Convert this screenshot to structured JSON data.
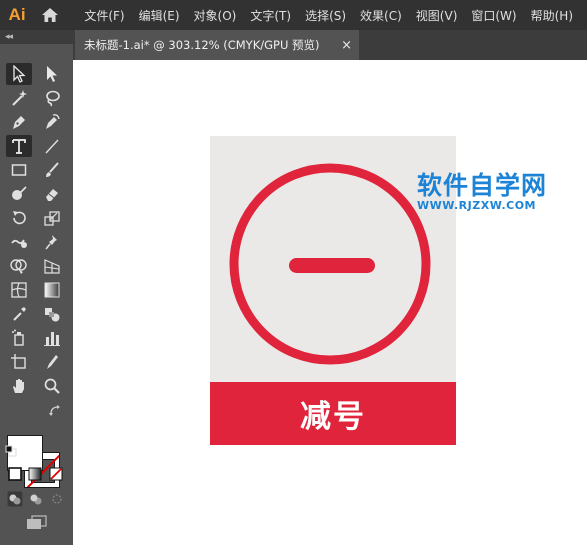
{
  "app": {
    "logo_text": "Ai",
    "accent": "#f79e32"
  },
  "menu": {
    "items": [
      {
        "label": "文件(F)"
      },
      {
        "label": "编辑(E)"
      },
      {
        "label": "对象(O)"
      },
      {
        "label": "文字(T)"
      },
      {
        "label": "选择(S)"
      },
      {
        "label": "效果(C)"
      },
      {
        "label": "视图(V)"
      },
      {
        "label": "窗口(W)"
      },
      {
        "label": "帮助(H)"
      }
    ]
  },
  "toolbar": {
    "collapse_glyph": "◂◂",
    "tools": [
      {
        "icon": "selection-arrow-icon"
      },
      {
        "icon": "direct-selection-icon"
      },
      {
        "icon": "magic-wand-icon"
      },
      {
        "icon": "lasso-icon"
      },
      {
        "icon": "pen-icon"
      },
      {
        "icon": "curvature-icon"
      },
      {
        "icon": "type-icon",
        "selected": true
      },
      {
        "icon": "line-segment-icon"
      },
      {
        "icon": "rectangle-icon"
      },
      {
        "icon": "paintbrush-icon"
      },
      {
        "icon": "shaper-icon"
      },
      {
        "icon": "eraser-icon"
      },
      {
        "icon": "rotate-icon"
      },
      {
        "icon": "scale-icon"
      },
      {
        "icon": "warp-icon"
      },
      {
        "icon": "pin-icon"
      },
      {
        "icon": "shape-builder-icon"
      },
      {
        "icon": "perspective-grid-icon"
      },
      {
        "icon": "mesh-icon"
      },
      {
        "icon": "gradient-icon"
      },
      {
        "icon": "eyedropper-icon"
      },
      {
        "icon": "blend-icon"
      },
      {
        "icon": "symbol-sprayer-icon"
      },
      {
        "icon": "column-graph-icon"
      },
      {
        "icon": "artboard-icon"
      },
      {
        "icon": "slice-icon"
      },
      {
        "icon": "hand-icon"
      },
      {
        "icon": "zoom-icon"
      }
    ],
    "fill_color": "#ffffff",
    "stroke_color": "none"
  },
  "document": {
    "tab_title": "未标题-1.ai* @ 303.12% (CMYK/GPU 预览)",
    "close_glyph": "×"
  },
  "artwork": {
    "background": "#eae9e7",
    "accent": "#e0243b",
    "label": "减号"
  },
  "watermark": {
    "main": "软件自学网",
    "sub": "WWW.RJZXW.COM",
    "color": "#1c83d6"
  }
}
